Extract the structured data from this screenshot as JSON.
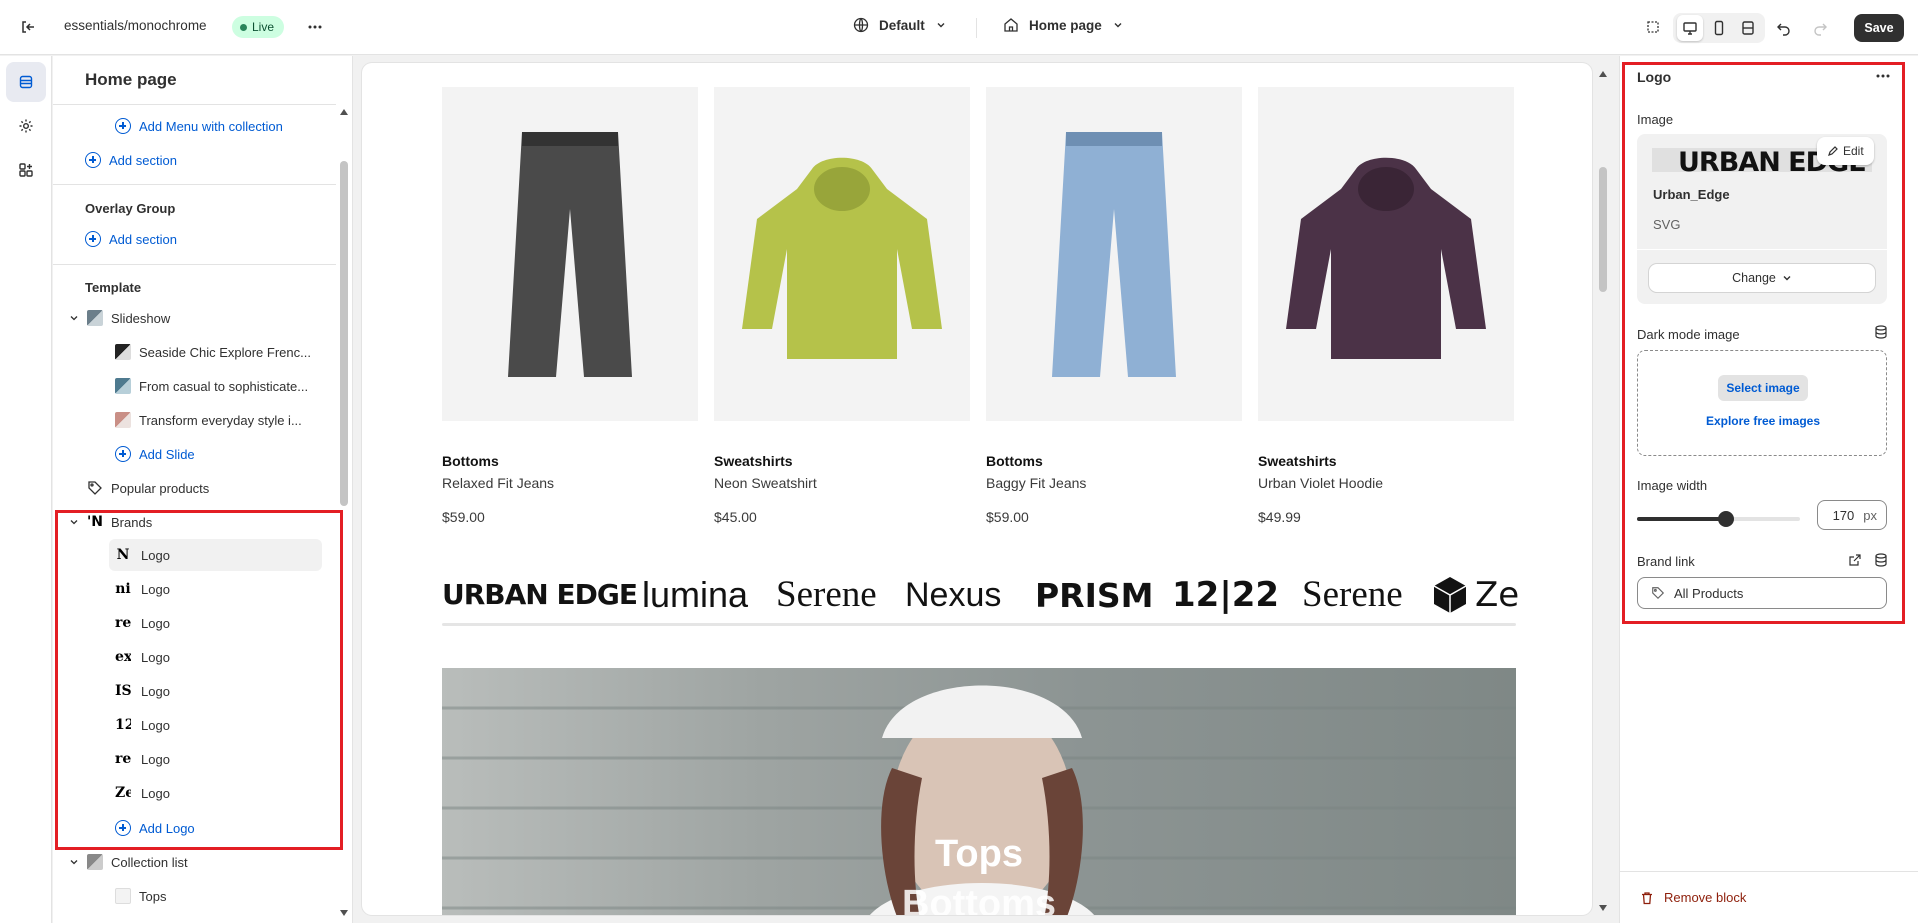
{
  "topbar": {
    "store_name": "essentials/monochrome",
    "live_badge": "Live",
    "theme_select": "Default",
    "page_select": "Home page",
    "save_label": "Save"
  },
  "sidebar": {
    "title": "Home page",
    "add_menu_with_collection": "Add Menu with collection",
    "add_section_1": "Add section",
    "overlay_group": "Overlay Group",
    "add_section_2": "Add section",
    "template": "Template",
    "slideshow": "Slideshow",
    "slides": [
      "Seaside Chic Explore Frenc...",
      "From casual to sophisticate...",
      "Transform everyday style i..."
    ],
    "add_slide": "Add Slide",
    "popular_products": "Popular products",
    "brands": "Brands",
    "logos": [
      {
        "thumb": "N",
        "label": "Logo"
      },
      {
        "thumb": "ni",
        "label": "Logo"
      },
      {
        "thumb": "re",
        "label": "Logo"
      },
      {
        "thumb": "ex",
        "label": "Logo"
      },
      {
        "thumb": "IS",
        "label": "Logo"
      },
      {
        "thumb": "12",
        "label": "Logo"
      },
      {
        "thumb": "re",
        "label": "Logo"
      },
      {
        "thumb": "Ze",
        "label": "Logo"
      }
    ],
    "add_logo": "Add Logo",
    "collection_list": "Collection list",
    "tops": "Tops"
  },
  "preview": {
    "products": [
      {
        "category": "Bottoms",
        "name": "Relaxed Fit Jeans",
        "price": "$59.00",
        "color": "#4a4a4a",
        "kind": "pants"
      },
      {
        "category": "Sweatshirts",
        "name": "Neon Sweatshirt",
        "price": "$45.00",
        "color": "#b5c24a",
        "kind": "hoodie"
      },
      {
        "category": "Bottoms",
        "name": "Baggy Fit Jeans",
        "price": "$59.00",
        "color": "#8fb0d4",
        "kind": "pants"
      },
      {
        "category": "Sweatshirts",
        "name": "Urban Violet Hoodie",
        "price": "$49.99",
        "color": "#4b3247",
        "kind": "hoodie"
      }
    ],
    "brands": [
      "URBAN EDGE",
      "lumina",
      "Serene",
      "Nexus",
      "PRISM",
      "12|22",
      "Serene",
      "Ze"
    ],
    "hero_titles": [
      "Tops",
      "Bottoms"
    ]
  },
  "panel": {
    "title": "Logo",
    "image_label": "Image",
    "edit_label": "Edit",
    "logo_preview_text": "URBAN EDGE",
    "file_name": "Urban_Edge",
    "file_type": "SVG",
    "change_label": "Change",
    "dark_mode_label": "Dark mode image",
    "select_image": "Select image",
    "explore_images": "Explore free images",
    "width_label": "Image width",
    "width_value": "170",
    "width_unit": "px",
    "width_fraction": 0.52,
    "brand_link_label": "Brand link",
    "brand_link_value": "All Products",
    "remove_block": "Remove block"
  },
  "colors": {
    "accent": "#005bd3",
    "highlight": "#e31e24",
    "live_bg": "#cdfee1",
    "danger": "#8e1f0b"
  }
}
